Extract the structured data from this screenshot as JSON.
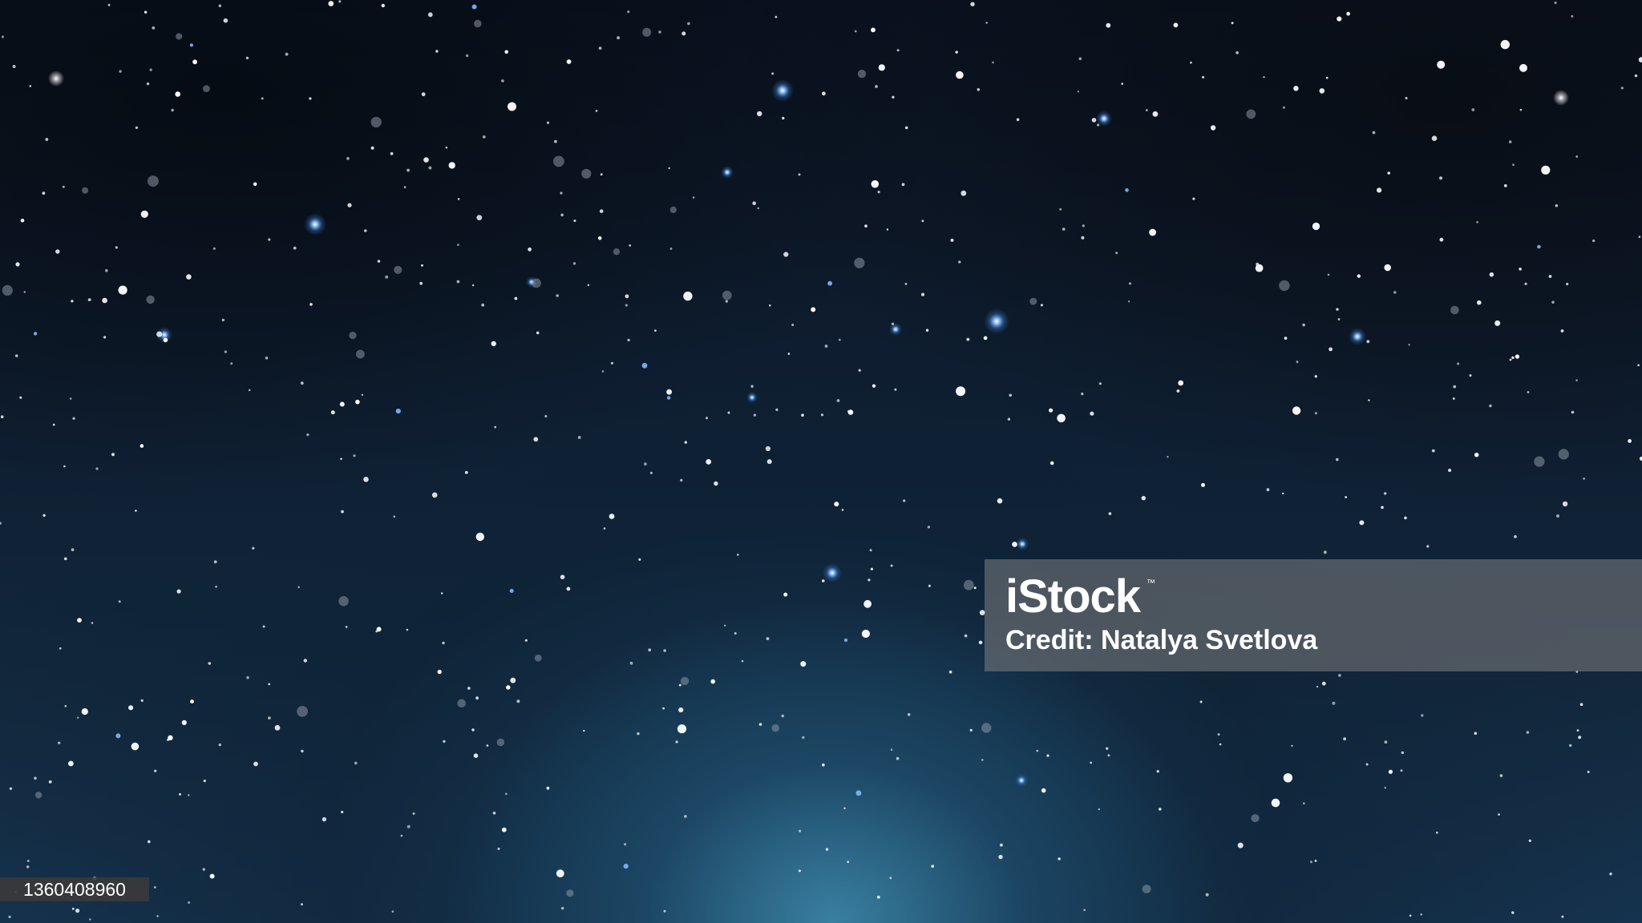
{
  "watermark": {
    "brand": "iStock",
    "trademark": "™",
    "credit": "Credit: Natalya Svetlova"
  },
  "image_id": "1360408960",
  "colors": {
    "sky_top": "#0a1220",
    "sky_bottom": "#163450",
    "glow": "#408caf",
    "star_white": "#ffffff",
    "star_blue": "#7fb8ff"
  }
}
